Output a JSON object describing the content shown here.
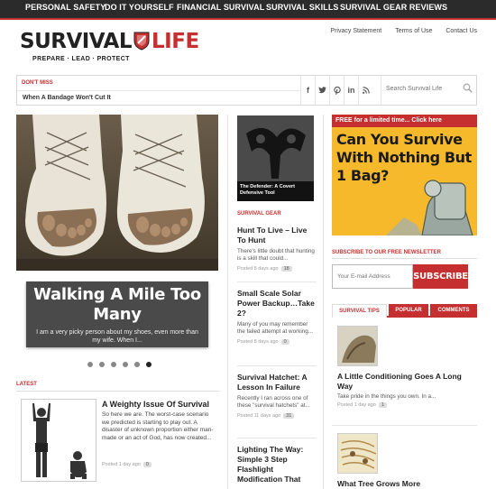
{
  "nav": {
    "items": [
      "PERSONAL SAFETY",
      "DO IT YOURSELF",
      "FINANCIAL SURVIVAL",
      "SURVIVAL SKILLS",
      "SURVIVAL GEAR REVIEWS"
    ]
  },
  "logo": {
    "word1": "SURVIVAL",
    "word2": "LIFE",
    "tagline": "PREPARE · LEAD · PROTECT"
  },
  "header_links": [
    "Privacy Statement",
    "Terms of Use",
    "Contact Us"
  ],
  "dont_miss": {
    "label": "DON'T MISS",
    "story": "When A Bandage Won't Cut It"
  },
  "social": [
    "f",
    "t",
    "p",
    "in",
    "rss"
  ],
  "search": {
    "placeholder": "Search Survival Life"
  },
  "slider": {
    "title": "Walking A Mile Too Many",
    "excerpt": "I am a very picky person about my shoes, even more than my wife. When I...",
    "slides": 6,
    "active_slide": 6
  },
  "latest": {
    "label": "LATEST",
    "title": "A Weighty Issue Of Survival",
    "excerpt": "So here we are. The worst-case scenario we predicted is starting to play out. A disaster of unknown proportion either man-made or an act of God, has now created...",
    "meta": "Posted 1 day ago",
    "comments": "0"
  },
  "feature": {
    "caption": "The Defender: A Covert Defensive Tool"
  },
  "survival_gear": {
    "label": "SURVIVAL GEAR",
    "items": [
      {
        "title": "Hunt To Live – Live To Hunt",
        "excerpt": "There's little doubt that hunting is a skill that could...",
        "meta": "Posted 8 days ago",
        "comments": "18"
      },
      {
        "title": "Small Scale Solar Power Backup…Take 2?",
        "excerpt": "Many of you may remember the failed attempt at working...",
        "meta": "Posted 8 days ago",
        "comments": "0"
      },
      {
        "title": "Survival Hatchet: A Lesson In Failure",
        "excerpt": "Recently I ran across one of these \"survival hatchets\" at...",
        "meta": "Posted 11 days ago",
        "comments": "31"
      },
      {
        "title": "Lighting The Way: Simple 3 Step Flashlight Modification That",
        "excerpt": "",
        "meta": "",
        "comments": ""
      }
    ]
  },
  "ad": {
    "top": "FREE for a limited time... Click here",
    "title": "Can You Survive With Nothing But 1 Bag?"
  },
  "newsletter": {
    "label": "SUBSCRIBE TO OUR FREE NEWSLETTER",
    "placeholder": "Your E-mail Address",
    "button": "SUBSCRIBE"
  },
  "tabs": {
    "items": [
      "SURVIVAL TIPS",
      "POPULAR",
      "COMMENTS"
    ],
    "active": "SURVIVAL TIPS"
  },
  "tips": [
    {
      "title": "A Little Conditioning Goes A Long Way",
      "excerpt": "Take pride in the things you own. In a...",
      "meta": "Posted 1 day ago",
      "comments": "1"
    },
    {
      "title": "What Tree Grows More",
      "excerpt": "",
      "meta": "",
      "comments": ""
    }
  ],
  "colors": {
    "brand_red": "#c62f2f",
    "nav_bg": "#2b2b2b",
    "ad_yellow": "#f6b92b"
  }
}
